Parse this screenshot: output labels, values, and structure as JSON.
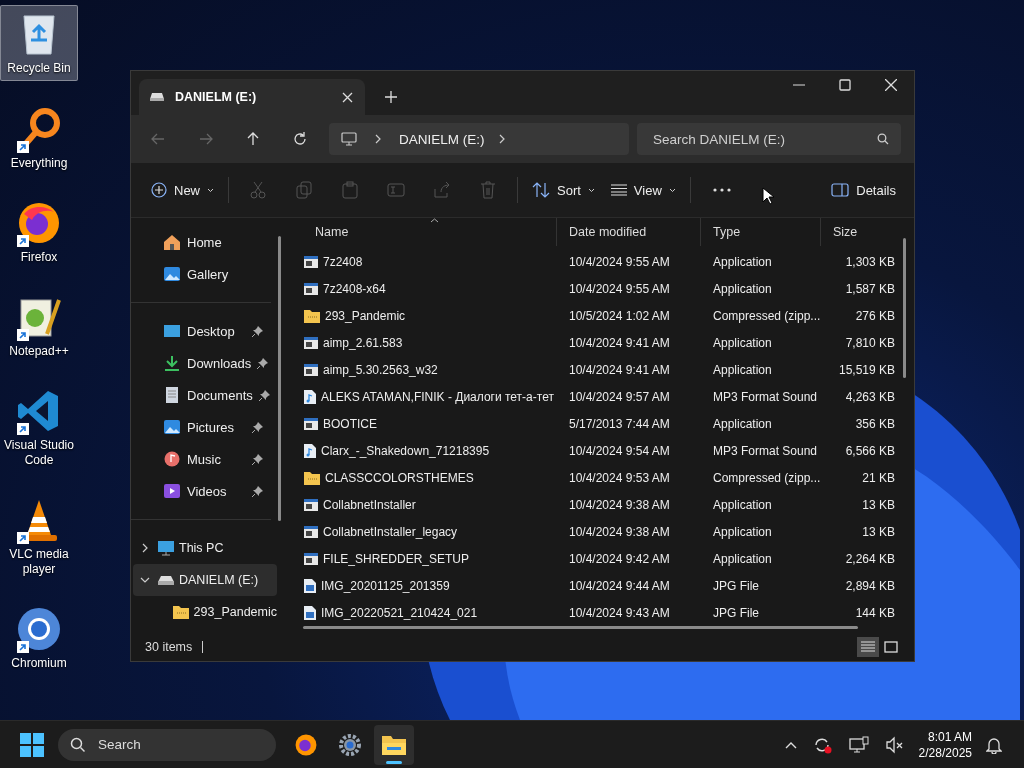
{
  "desktop_icons": [
    {
      "label": "Recycle Bin",
      "kind": "recycle",
      "shortcut": false,
      "selected": true
    },
    {
      "label": "Everything",
      "kind": "magnifier",
      "shortcut": true,
      "selected": false
    },
    {
      "label": "Firefox",
      "kind": "fox",
      "shortcut": true,
      "selected": false
    },
    {
      "label": "Notepad++",
      "kind": "notepad",
      "shortcut": true,
      "selected": false
    },
    {
      "label": "Visual Studio Code",
      "kind": "code",
      "shortcut": true,
      "selected": false
    },
    {
      "label": "VLC media player",
      "kind": "cone",
      "shortcut": true,
      "selected": false
    },
    {
      "label": "Chromium",
      "kind": "chromium",
      "shortcut": true,
      "selected": false
    }
  ],
  "window": {
    "tab": {
      "title": "DANIELM (E:)"
    },
    "breadcrumb": [
      "DANIELM (E:)"
    ],
    "search": {
      "placeholder": "Search DANIELM (E:)"
    },
    "toolbar": {
      "new_label": "New",
      "actions": [
        {
          "kind": "cut",
          "disabled": true
        },
        {
          "kind": "copy",
          "disabled": true
        },
        {
          "kind": "paste",
          "disabled": true
        },
        {
          "kind": "rename",
          "disabled": true
        },
        {
          "kind": "share",
          "disabled": true
        },
        {
          "kind": "delete",
          "disabled": true
        }
      ],
      "sort_label": "Sort",
      "view_label": "View",
      "details_label": "Details"
    },
    "sidebar": {
      "quick": [
        {
          "label": "Home",
          "kind": "home"
        },
        {
          "label": "Gallery",
          "kind": "gallery"
        }
      ],
      "pinned": [
        {
          "label": "Desktop",
          "kind": "desktop",
          "pinned": true
        },
        {
          "label": "Downloads",
          "kind": "downloads",
          "pinned": true
        },
        {
          "label": "Documents",
          "kind": "documents",
          "pinned": true
        },
        {
          "label": "Pictures",
          "kind": "pictures",
          "pinned": true
        },
        {
          "label": "Music",
          "kind": "music",
          "pinned": true
        },
        {
          "label": "Videos",
          "kind": "videos",
          "pinned": true
        }
      ],
      "tree": [
        {
          "label": "This PC",
          "kind": "pc",
          "expanded": false,
          "selected": false
        },
        {
          "label": "DANIELM (E:)",
          "kind": "drive",
          "expanded": true,
          "selected": true,
          "children": [
            {
              "label": "293_Pandemic",
              "kind": "zip",
              "selected": false
            }
          ]
        }
      ]
    },
    "table": {
      "columns": [
        {
          "label": "Name",
          "sorted": true
        },
        {
          "label": "Date modified",
          "sorted": false
        },
        {
          "label": "Type",
          "sorted": false
        },
        {
          "label": "Size",
          "sorted": false
        }
      ],
      "rows": [
        {
          "name": "7z2408",
          "date": "10/4/2024 9:55 AM",
          "type": "Application",
          "size": "1,303 KB",
          "kind": "exe"
        },
        {
          "name": "7z2408-x64",
          "date": "10/4/2024 9:55 AM",
          "type": "Application",
          "size": "1,587 KB",
          "kind": "exe"
        },
        {
          "name": "293_Pandemic",
          "date": "10/5/2024 1:02 AM",
          "type": "Compressed (zipp...",
          "size": "276 KB",
          "kind": "zip"
        },
        {
          "name": "aimp_2.61.583",
          "date": "10/4/2024 9:41 AM",
          "type": "Application",
          "size": "7,810 KB",
          "kind": "exe"
        },
        {
          "name": "aimp_5.30.2563_w32",
          "date": "10/4/2024 9:41 AM",
          "type": "Application",
          "size": "15,519 KB",
          "kind": "exe"
        },
        {
          "name": "ALEKS ATAMAN,FINIK - Диалоги тет-а-тет",
          "date": "10/4/2024 9:57 AM",
          "type": "MP3 Format Sound",
          "size": "4,263 KB",
          "kind": "audio"
        },
        {
          "name": "BOOTICE",
          "date": "5/17/2013 7:44 AM",
          "type": "Application",
          "size": "356 KB",
          "kind": "exe"
        },
        {
          "name": "Clarx_-_Shakedown_71218395",
          "date": "10/4/2024 9:54 AM",
          "type": "MP3 Format Sound",
          "size": "6,566 KB",
          "kind": "audio"
        },
        {
          "name": "CLASSCCOLORSTHEMES",
          "date": "10/4/2024 9:53 AM",
          "type": "Compressed (zipp...",
          "size": "21 KB",
          "kind": "zip"
        },
        {
          "name": "CollabnetInstaller",
          "date": "10/4/2024 9:38 AM",
          "type": "Application",
          "size": "13 KB",
          "kind": "exe"
        },
        {
          "name": "CollabnetInstaller_legacy",
          "date": "10/4/2024 9:38 AM",
          "type": "Application",
          "size": "13 KB",
          "kind": "exe"
        },
        {
          "name": "FILE_SHREDDER_SETUP",
          "date": "10/4/2024 9:42 AM",
          "type": "Application",
          "size": "2,264 KB",
          "kind": "exe"
        },
        {
          "name": "IMG_20201125_201359",
          "date": "10/4/2024 9:44 AM",
          "type": "JPG File",
          "size": "2,894 KB",
          "kind": "image"
        },
        {
          "name": "IMG_20220521_210424_021",
          "date": "10/4/2024 9:43 AM",
          "type": "JPG File",
          "size": "144 KB",
          "kind": "image"
        }
      ]
    },
    "status_bar": {
      "count": "30 items",
      "view_modes": [
        {
          "kind": "details",
          "selected": true
        },
        {
          "kind": "tiles",
          "selected": false
        }
      ]
    }
  },
  "taskbar": {
    "search": {
      "placeholder": "Search"
    },
    "apps": [
      {
        "kind": "fox",
        "active": false
      },
      {
        "kind": "gear",
        "active": false
      },
      {
        "kind": "folder",
        "active": true
      }
    ],
    "time": "8:01 AM",
    "date": "2/28/2025"
  }
}
